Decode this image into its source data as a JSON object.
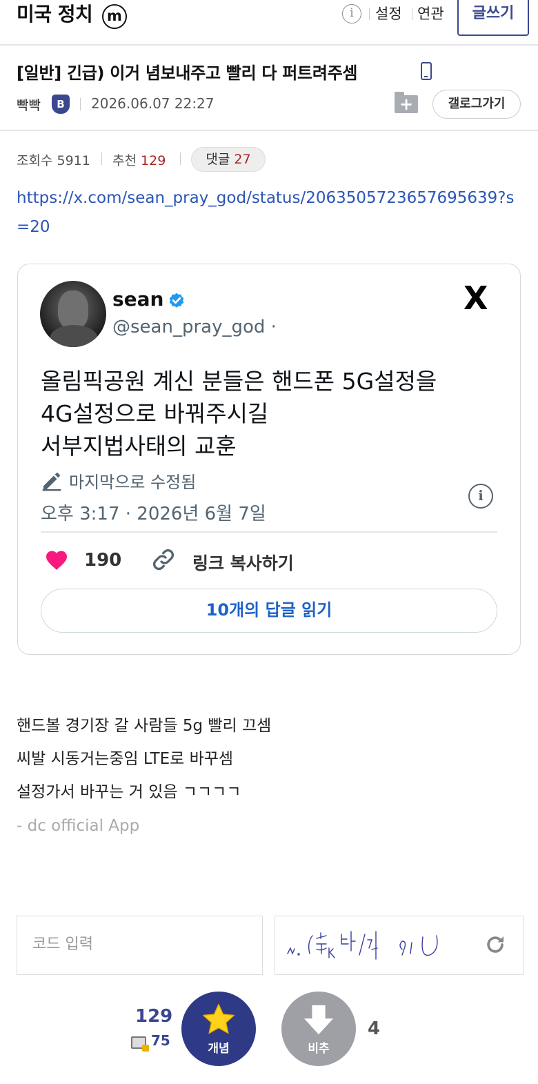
{
  "header": {
    "gallery_title": "미국 정치",
    "minor_badge": "m",
    "info_icon": "info-icon",
    "settings_label": "설정",
    "related_label": "연관",
    "write_button": "글쓰기"
  },
  "post": {
    "title": "[일반] 긴급) 이거 념보내주고 빨리 다 퍼트려주셈",
    "device_icon": "mobile-phone-icon",
    "author": "빡빡",
    "author_badge": "B",
    "date": "2026.06.07 22:27",
    "gallog_button": "갤로그가기",
    "stats": {
      "views_label": "조회수",
      "views": "5911",
      "recommend_label": "추천",
      "recommend": "129",
      "comments_label": "댓글",
      "comments": "27"
    },
    "link_url": "https://x.com/sean_pray_god/status/2063505723657695639?s=20",
    "body_lines": [
      "핸드볼 경기장 갈 사람들 5g 빨리 끄셈",
      "씨발 시동거는중임 LTE로 바꾸셈",
      "설정가서 바꾸는 거 있음 ㄱㄱㄱㄱ"
    ],
    "signature": "- dc official App"
  },
  "tweet": {
    "name": "sean",
    "handle": "@sean_pray_god ·",
    "text_lines": [
      "올림픽공원 계신 분들은 핸드폰 5G설정을",
      "4G설정으로 바꿔주시길",
      "서부지법사태의 교훈"
    ],
    "edited_label": "마지막으로 수정됨",
    "timestamp": "오후 3:17 · 2026년 6월 7일",
    "likes": "190",
    "copy_link_label": "링크 복사하기",
    "replies_button": "10개의 답글 읽기",
    "logo": "X",
    "accent_color": "#1d9bf0",
    "heart_color": "#f91880"
  },
  "captcha": {
    "placeholder": "코드 입력",
    "image_text": "n. (추k터/2 97)"
  },
  "vote": {
    "up_count": "129",
    "fix_count": "75",
    "up_label": "개념",
    "down_label": "비추",
    "down_count": "4",
    "up_color": "#2e3a85",
    "down_color": "#9fa0a6"
  }
}
